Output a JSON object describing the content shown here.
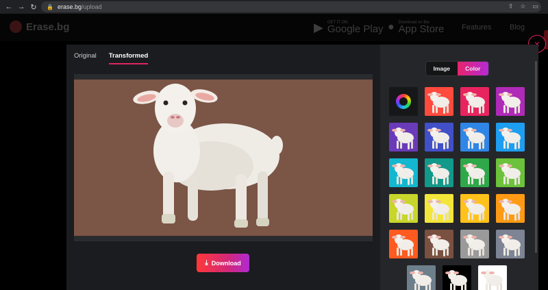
{
  "browser": {
    "url_domain": "erase.bg",
    "url_path": "/upload"
  },
  "site": {
    "logo_text": "Erase.bg",
    "google_play_small": "GET IT ON",
    "google_play": "Google Play",
    "app_store_small": "Download on the",
    "app_store": "App Store",
    "nav_features": "Features",
    "nav_blog": "Blog"
  },
  "modal": {
    "close_glyph": "×",
    "tabs": [
      {
        "label": "Original",
        "active": false
      },
      {
        "label": "Transformed",
        "active": true
      }
    ],
    "preview_background_color": "#7b5546",
    "download_label": "Download",
    "bg_toggle": {
      "image_label": "Image",
      "color_label": "Color",
      "selected": "Color"
    },
    "swatch_colors": [
      "#ff4a3d",
      "#e8245e",
      "#b02ab8",
      "#6a3bb8",
      "#4150c8",
      "#2f86e6",
      "#1d9ef0",
      "#14b7d0",
      "#11998a",
      "#2fa84a",
      "#6cc23a",
      "#c8d62c",
      "#f3e63a",
      "#ffc21a",
      "#ff9a14",
      "#ff5a1f",
      "#7a5040",
      "#9a9a9a",
      "#7d8494",
      "#6e7f8c",
      "#000000",
      "#ffffff"
    ]
  },
  "colors": {
    "accent": "#e0245e",
    "accent_purple": "#b02ad1"
  }
}
